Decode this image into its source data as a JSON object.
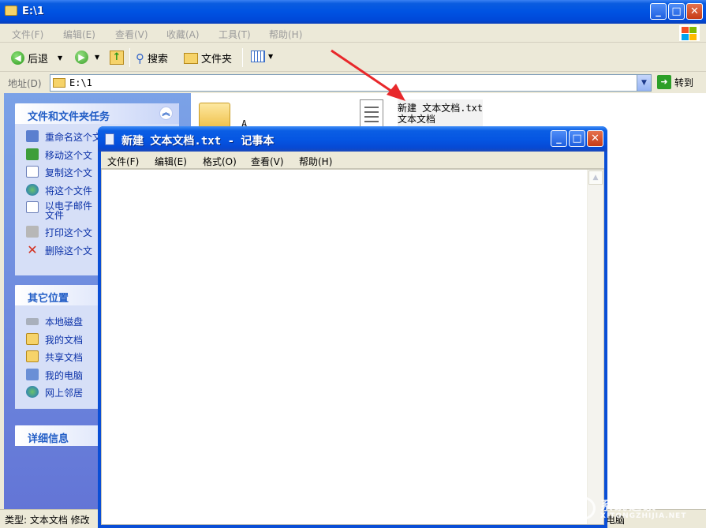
{
  "explorer": {
    "title": "E:\\1",
    "menu": [
      "文件(F)",
      "编辑(E)",
      "查看(V)",
      "收藏(A)",
      "工具(T)",
      "帮助(H)"
    ],
    "toolbar": {
      "back_label": "后退",
      "search_label": "搜索",
      "folders_label": "文件夹"
    },
    "address": {
      "label": "地址(D)",
      "value": "E:\\1",
      "goto_label": "转到"
    },
    "tasks_panel": {
      "title": "文件和文件夹任务",
      "items": [
        {
          "label": "重命名这个文",
          "icon": "rename-icon"
        },
        {
          "label": "移动这个文",
          "icon": "move-icon"
        },
        {
          "label": "复制这个文",
          "icon": "copy-icon"
        },
        {
          "label": "将这个文件",
          "icon": "publish-web-icon"
        },
        {
          "label": "以电子邮件",
          "label2": "文件",
          "icon": "email-icon"
        },
        {
          "label": "打印这个文",
          "icon": "print-icon"
        },
        {
          "label": "删除这个文",
          "icon": "delete-icon"
        }
      ]
    },
    "places_panel": {
      "title": "其它位置",
      "items": [
        {
          "label": "本地磁盘",
          "icon": "local-disk-icon"
        },
        {
          "label": "我的文档",
          "icon": "my-documents-icon"
        },
        {
          "label": "共享文档",
          "icon": "shared-documents-icon"
        },
        {
          "label": "我的电脑",
          "icon": "my-computer-icon"
        },
        {
          "label": "网上邻居",
          "icon": "network-places-icon"
        }
      ]
    },
    "details_panel": {
      "title": "详细信息"
    },
    "files": [
      {
        "name": "A",
        "icon": "folder-icon"
      },
      {
        "name": "新建 文本文档.txt",
        "subtitle": "文本文档",
        "icon": "text-document-icon"
      }
    ],
    "status": {
      "left": "类型: 文本文档 修改",
      "right": "电脑"
    }
  },
  "notepad": {
    "title": "新建 文本文档.txt - 记事本",
    "menu": [
      "文件(F)",
      "编辑(E)",
      "格式(O)",
      "查看(V)",
      "帮助(H)"
    ],
    "content": ""
  },
  "watermark": {
    "text": "系统之家",
    "url": "XITONGZHIJIA.NET"
  },
  "colors": {
    "xp_title_blue": "#0053e2",
    "panel_text_blue": "#0c32a8",
    "panel_head_blue": "#215dc6",
    "annotation_arrow": "#e8282b"
  }
}
